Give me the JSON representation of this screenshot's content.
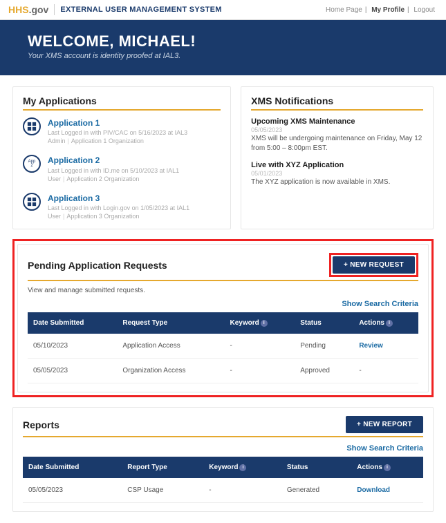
{
  "topbar": {
    "logo_hhs": "HHS",
    "logo_gov": ".gov",
    "system_name": "EXTERNAL USER MANAGEMENT SYSTEM",
    "links": {
      "home": "Home Page",
      "profile": "My Profile",
      "logout": "Logout"
    }
  },
  "hero": {
    "welcome": "WELCOME, MICHAEL!",
    "subtitle": "Your XMS account is identity proofed at IAL3."
  },
  "apps": {
    "title": "My Applications",
    "items": [
      {
        "name": "Application 1",
        "last": "Last Logged in with PIV/CAC on 5/16/2023 at IAL3",
        "role": "Admin",
        "org": "Application 1 Organization",
        "icon": "grid"
      },
      {
        "name": "Application 2",
        "last": "Last Logged in with ID.me on 5/10/2023 at IAL1",
        "role": "User",
        "org": "Application 2 Organization",
        "icon": "badge",
        "badge": "App 2"
      },
      {
        "name": "Application 3",
        "last": "Last Logged in with Login.gov on 1/05/2023 at IAL1",
        "role": "User",
        "org": "Application 3 Organization",
        "icon": "grid"
      }
    ]
  },
  "notifications": {
    "title": "XMS Notifications",
    "items": [
      {
        "title": "Upcoming XMS Maintenance",
        "date": "05/05/2023",
        "body": "XMS will be undergoing maintenance on Friday, May 12 from 5:00 – 8:00pm EST."
      },
      {
        "title": "Live with XYZ Application",
        "date": "05/01/2023",
        "body": "The XYZ application is now available in XMS."
      }
    ]
  },
  "pending": {
    "title": "Pending Application Requests",
    "btn": "+ NEW REQUEST",
    "subtext": "View and manage submitted requests.",
    "search_link": "Show Search Criteria",
    "columns": {
      "date": "Date Submitted",
      "type": "Request Type",
      "keyword": "Keyword",
      "status": "Status",
      "actions": "Actions"
    },
    "rows": [
      {
        "date": "05/10/2023",
        "type": "Application Access",
        "keyword": "-",
        "status": "Pending",
        "action": "Review"
      },
      {
        "date": "05/05/2023",
        "type": "Organization Access",
        "keyword": "-",
        "status": "Approved",
        "action": "-"
      }
    ]
  },
  "reports": {
    "title": "Reports",
    "btn": "+ NEW REPORT",
    "search_link": "Show Search Criteria",
    "columns": {
      "date": "Date Submitted",
      "type": "Report Type",
      "keyword": "Keyword",
      "status": "Status",
      "actions": "Actions"
    },
    "rows": [
      {
        "date": "05/05/2023",
        "type": "CSP Usage",
        "keyword": "-",
        "status": "Generated",
        "action": "Download"
      }
    ]
  }
}
